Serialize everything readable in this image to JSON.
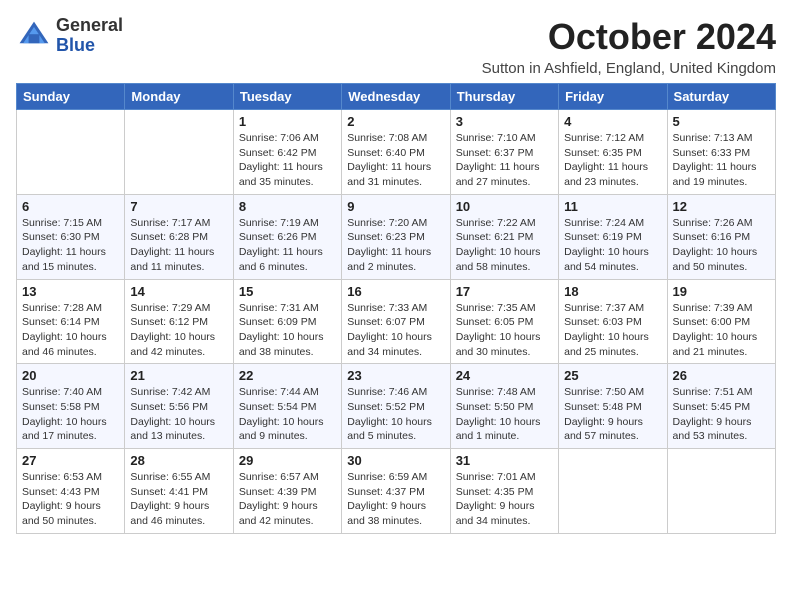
{
  "header": {
    "logo": {
      "general": "General",
      "blue": "Blue"
    },
    "title": "October 2024",
    "subtitle": "Sutton in Ashfield, England, United Kingdom"
  },
  "weekdays": [
    "Sunday",
    "Monday",
    "Tuesday",
    "Wednesday",
    "Thursday",
    "Friday",
    "Saturday"
  ],
  "weeks": [
    [
      {
        "day": "",
        "sunrise": "",
        "sunset": "",
        "daylight": ""
      },
      {
        "day": "",
        "sunrise": "",
        "sunset": "",
        "daylight": ""
      },
      {
        "day": "1",
        "sunrise": "Sunrise: 7:06 AM",
        "sunset": "Sunset: 6:42 PM",
        "daylight": "Daylight: 11 hours and 35 minutes."
      },
      {
        "day": "2",
        "sunrise": "Sunrise: 7:08 AM",
        "sunset": "Sunset: 6:40 PM",
        "daylight": "Daylight: 11 hours and 31 minutes."
      },
      {
        "day": "3",
        "sunrise": "Sunrise: 7:10 AM",
        "sunset": "Sunset: 6:37 PM",
        "daylight": "Daylight: 11 hours and 27 minutes."
      },
      {
        "day": "4",
        "sunrise": "Sunrise: 7:12 AM",
        "sunset": "Sunset: 6:35 PM",
        "daylight": "Daylight: 11 hours and 23 minutes."
      },
      {
        "day": "5",
        "sunrise": "Sunrise: 7:13 AM",
        "sunset": "Sunset: 6:33 PM",
        "daylight": "Daylight: 11 hours and 19 minutes."
      }
    ],
    [
      {
        "day": "6",
        "sunrise": "Sunrise: 7:15 AM",
        "sunset": "Sunset: 6:30 PM",
        "daylight": "Daylight: 11 hours and 15 minutes."
      },
      {
        "day": "7",
        "sunrise": "Sunrise: 7:17 AM",
        "sunset": "Sunset: 6:28 PM",
        "daylight": "Daylight: 11 hours and 11 minutes."
      },
      {
        "day": "8",
        "sunrise": "Sunrise: 7:19 AM",
        "sunset": "Sunset: 6:26 PM",
        "daylight": "Daylight: 11 hours and 6 minutes."
      },
      {
        "day": "9",
        "sunrise": "Sunrise: 7:20 AM",
        "sunset": "Sunset: 6:23 PM",
        "daylight": "Daylight: 11 hours and 2 minutes."
      },
      {
        "day": "10",
        "sunrise": "Sunrise: 7:22 AM",
        "sunset": "Sunset: 6:21 PM",
        "daylight": "Daylight: 10 hours and 58 minutes."
      },
      {
        "day": "11",
        "sunrise": "Sunrise: 7:24 AM",
        "sunset": "Sunset: 6:19 PM",
        "daylight": "Daylight: 10 hours and 54 minutes."
      },
      {
        "day": "12",
        "sunrise": "Sunrise: 7:26 AM",
        "sunset": "Sunset: 6:16 PM",
        "daylight": "Daylight: 10 hours and 50 minutes."
      }
    ],
    [
      {
        "day": "13",
        "sunrise": "Sunrise: 7:28 AM",
        "sunset": "Sunset: 6:14 PM",
        "daylight": "Daylight: 10 hours and 46 minutes."
      },
      {
        "day": "14",
        "sunrise": "Sunrise: 7:29 AM",
        "sunset": "Sunset: 6:12 PM",
        "daylight": "Daylight: 10 hours and 42 minutes."
      },
      {
        "day": "15",
        "sunrise": "Sunrise: 7:31 AM",
        "sunset": "Sunset: 6:09 PM",
        "daylight": "Daylight: 10 hours and 38 minutes."
      },
      {
        "day": "16",
        "sunrise": "Sunrise: 7:33 AM",
        "sunset": "Sunset: 6:07 PM",
        "daylight": "Daylight: 10 hours and 34 minutes."
      },
      {
        "day": "17",
        "sunrise": "Sunrise: 7:35 AM",
        "sunset": "Sunset: 6:05 PM",
        "daylight": "Daylight: 10 hours and 30 minutes."
      },
      {
        "day": "18",
        "sunrise": "Sunrise: 7:37 AM",
        "sunset": "Sunset: 6:03 PM",
        "daylight": "Daylight: 10 hours and 25 minutes."
      },
      {
        "day": "19",
        "sunrise": "Sunrise: 7:39 AM",
        "sunset": "Sunset: 6:00 PM",
        "daylight": "Daylight: 10 hours and 21 minutes."
      }
    ],
    [
      {
        "day": "20",
        "sunrise": "Sunrise: 7:40 AM",
        "sunset": "Sunset: 5:58 PM",
        "daylight": "Daylight: 10 hours and 17 minutes."
      },
      {
        "day": "21",
        "sunrise": "Sunrise: 7:42 AM",
        "sunset": "Sunset: 5:56 PM",
        "daylight": "Daylight: 10 hours and 13 minutes."
      },
      {
        "day": "22",
        "sunrise": "Sunrise: 7:44 AM",
        "sunset": "Sunset: 5:54 PM",
        "daylight": "Daylight: 10 hours and 9 minutes."
      },
      {
        "day": "23",
        "sunrise": "Sunrise: 7:46 AM",
        "sunset": "Sunset: 5:52 PM",
        "daylight": "Daylight: 10 hours and 5 minutes."
      },
      {
        "day": "24",
        "sunrise": "Sunrise: 7:48 AM",
        "sunset": "Sunset: 5:50 PM",
        "daylight": "Daylight: 10 hours and 1 minute."
      },
      {
        "day": "25",
        "sunrise": "Sunrise: 7:50 AM",
        "sunset": "Sunset: 5:48 PM",
        "daylight": "Daylight: 9 hours and 57 minutes."
      },
      {
        "day": "26",
        "sunrise": "Sunrise: 7:51 AM",
        "sunset": "Sunset: 5:45 PM",
        "daylight": "Daylight: 9 hours and 53 minutes."
      }
    ],
    [
      {
        "day": "27",
        "sunrise": "Sunrise: 6:53 AM",
        "sunset": "Sunset: 4:43 PM",
        "daylight": "Daylight: 9 hours and 50 minutes."
      },
      {
        "day": "28",
        "sunrise": "Sunrise: 6:55 AM",
        "sunset": "Sunset: 4:41 PM",
        "daylight": "Daylight: 9 hours and 46 minutes."
      },
      {
        "day": "29",
        "sunrise": "Sunrise: 6:57 AM",
        "sunset": "Sunset: 4:39 PM",
        "daylight": "Daylight: 9 hours and 42 minutes."
      },
      {
        "day": "30",
        "sunrise": "Sunrise: 6:59 AM",
        "sunset": "Sunset: 4:37 PM",
        "daylight": "Daylight: 9 hours and 38 minutes."
      },
      {
        "day": "31",
        "sunrise": "Sunrise: 7:01 AM",
        "sunset": "Sunset: 4:35 PM",
        "daylight": "Daylight: 9 hours and 34 minutes."
      },
      {
        "day": "",
        "sunrise": "",
        "sunset": "",
        "daylight": ""
      },
      {
        "day": "",
        "sunrise": "",
        "sunset": "",
        "daylight": ""
      }
    ]
  ]
}
